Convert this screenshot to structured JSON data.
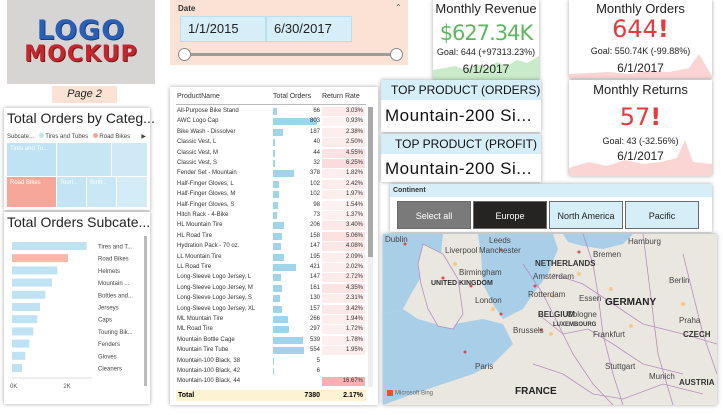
{
  "logo": {
    "line1": "LOGO",
    "line2": "MOCKUP"
  },
  "page_label": "Page 2",
  "date_slicer": {
    "title": "Date",
    "start": "1/1/2015",
    "end": "6/30/2017"
  },
  "kpi_revenue": {
    "title": "Monthly Revenue",
    "value": "$627.34K",
    "goal": "Goal: 644 (+97313.23%)",
    "date": "6/1/2017",
    "color": "#5cb85c"
  },
  "kpi_orders": {
    "title": "Monthly Orders",
    "value": "644",
    "flag": "!",
    "goal": "Goal: 550.74K (-99.88%)",
    "date": "6/1/2017",
    "color": "#e8393d"
  },
  "kpi_returns": {
    "title": "Monthly Returns",
    "value": "57",
    "flag": "!",
    "goal": "Goal: 43 (-32.56%)",
    "date": "6/1/2017",
    "color": "#e8393d"
  },
  "top_product_orders": {
    "title": "TOP PRODUCT (ORDERS)",
    "value": "Mountain-200 Si..."
  },
  "top_product_profit": {
    "title": "TOP PRODUCT (PROFIT)",
    "value": "Mountain-200 Si..."
  },
  "orders_by_category": {
    "title": "Total Orders by Categ...",
    "legend_label": "Subcate...",
    "legend_items": [
      "Tires and Tubes",
      "Road Bikes"
    ],
    "tiles": [
      "Tires and Tu...",
      "Road Bikes",
      "Touri...",
      "Bottl..."
    ]
  },
  "orders_subcategory": {
    "title": "Total Orders  Subcate...",
    "axis": [
      "0K",
      "2K"
    ],
    "chart_data": {
      "type": "bar",
      "categories": [
        "Tires and T...",
        "Road Bikes",
        "Helmets",
        "Mountain ...",
        "Bottles and...",
        "Jerseys",
        "Caps",
        "Touring Bik...",
        "Fenders",
        "Gloves",
        "Cleaners"
      ],
      "values": [
        2800,
        2100,
        1700,
        1500,
        1250,
        1050,
        950,
        800,
        650,
        500,
        380
      ],
      "xlim": [
        0,
        3000
      ]
    }
  },
  "product_table": {
    "headers": [
      "ProductName",
      "Total Orders",
      "Return Rate"
    ],
    "rows": [
      [
        "All-Purpose Bike Stand",
        "66",
        "3.03%"
      ],
      [
        "AWC Logo Cap",
        "803",
        "0.93%"
      ],
      [
        "Bike Wash - Dissolver",
        "187",
        "2.38%"
      ],
      [
        "Classic Vest, L",
        "40",
        "2.50%"
      ],
      [
        "Classic Vest, M",
        "44",
        "4.55%"
      ],
      [
        "Classic Vest, S",
        "32",
        "6.25%"
      ],
      [
        "Fender Set - Mountain",
        "378",
        "1.82%"
      ],
      [
        "Half-Finger Gloves, L",
        "102",
        "2.42%"
      ],
      [
        "Half-Finger Gloves, M",
        "102",
        "1.97%"
      ],
      [
        "Half-Finger Gloves, S",
        "98",
        "1.54%"
      ],
      [
        "Hitch Rack - 4-Bike",
        "73",
        "1.37%"
      ],
      [
        "HL Mountain Tire",
        "206",
        "3.40%"
      ],
      [
        "HL Road Tire",
        "158",
        "5.06%"
      ],
      [
        "Hydration Pack - 70 oz.",
        "147",
        "4.08%"
      ],
      [
        "LL Mountain Tire",
        "195",
        "2.09%"
      ],
      [
        "LL Road Tire",
        "421",
        "2.02%"
      ],
      [
        "Long-Sleeve Logo Jersey, L",
        "147",
        "2.72%"
      ],
      [
        "Long-Sleeve Logo Jersey, M",
        "161",
        "4.35%"
      ],
      [
        "Long-Sleeve Logo Jersey, S",
        "130",
        "2.31%"
      ],
      [
        "Long-Sleeve Logo Jersey, XL",
        "157",
        "3.42%"
      ],
      [
        "ML Mountain Tire",
        "266",
        "1.94%"
      ],
      [
        "ML Road Tire",
        "297",
        "1.72%"
      ],
      [
        "Mountain Bottle Cage",
        "539",
        "1.78%"
      ],
      [
        "Mountain Tire Tube",
        "554",
        "1.95%"
      ],
      [
        "Mountain-100 Black, 38",
        "5",
        ""
      ],
      [
        "Mountain-100 Black, 42",
        "6",
        ""
      ],
      [
        "Mountain-100 Black, 44",
        "",
        "16.67%"
      ]
    ],
    "total": [
      "Total",
      "7380",
      "2.17%"
    ]
  },
  "continent_slicer": {
    "title": "Continent",
    "options": [
      "Select all",
      "Europe",
      "North America",
      "Pacific"
    ],
    "selected": "Europe"
  },
  "map": {
    "labels": [
      "Dublin",
      "Leeds",
      "Liverpool",
      "Manchester",
      "Birmingham",
      "UNITED KINGDOM",
      "London",
      "Hamburg",
      "NETHERLANDS",
      "Bremen",
      "Berlin",
      "Amsterdam",
      "Rotterdam",
      "BELGIUM",
      "Essen",
      "Cologne",
      "Frankfurt",
      "GERMANY",
      "LUXEMBOURG",
      "Praha",
      "CZECH",
      "Stuttgart",
      "Munich",
      "AUSTRIA",
      "FRANCE",
      "Paris",
      "Brussels"
    ],
    "attribution": "Microsoft Bing"
  }
}
